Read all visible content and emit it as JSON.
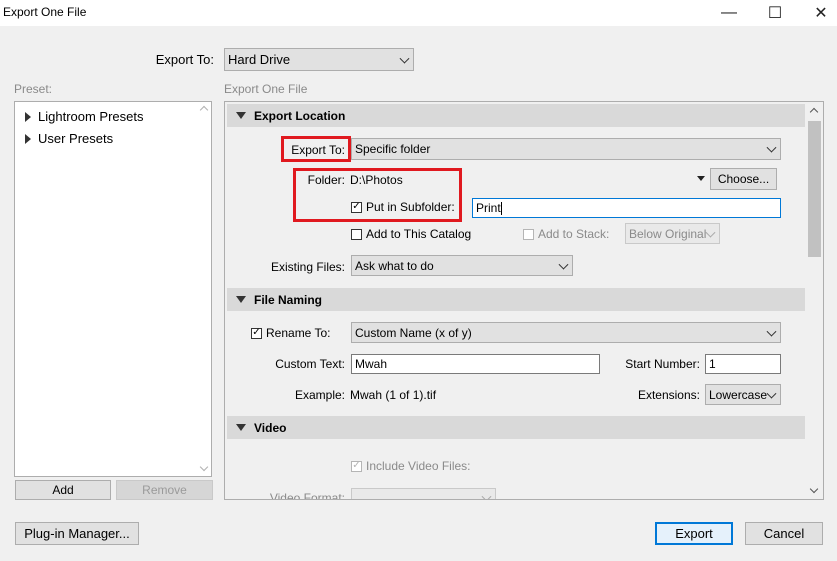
{
  "window": {
    "title": "Export One File",
    "minimize_glyph": "—",
    "maximize_glyph": "☐",
    "close_glyph": "✕"
  },
  "top": {
    "export_to_label": "Export To:",
    "export_to_value": "Hard Drive"
  },
  "preset": {
    "label": "Preset:",
    "items": [
      {
        "label": "Lightroom Presets"
      },
      {
        "label": "User Presets"
      }
    ],
    "add_label": "Add",
    "remove_label": "Remove"
  },
  "panel": {
    "label": "Export One File"
  },
  "export_location": {
    "header": "Export Location",
    "export_to_label": "Export To:",
    "export_to_value": "Specific folder",
    "folder_label": "Folder:",
    "folder_value": "D:\\Photos",
    "choose_label": "Choose...",
    "put_in_subfolder_label": "Put in Subfolder:",
    "put_in_subfolder_checked": true,
    "subfolder_value": "Print",
    "add_to_catalog_label": "Add to This Catalog",
    "add_to_stack_label": "Add to Stack:",
    "stack_position_value": "Below Original",
    "existing_files_label": "Existing Files:",
    "existing_files_value": "Ask what to do"
  },
  "file_naming": {
    "header": "File Naming",
    "rename_to_label": "Rename To:",
    "rename_checked": true,
    "rename_template_value": "Custom Name (x of y)",
    "custom_text_label": "Custom Text:",
    "custom_text_value": "Mwah",
    "start_number_label": "Start Number:",
    "start_number_value": "1",
    "example_label": "Example:",
    "example_value": "Mwah (1 of 1).tif",
    "extensions_label": "Extensions:",
    "extensions_value": "Lowercase"
  },
  "video": {
    "header": "Video",
    "include_video_label": "Include Video Files:",
    "video_format_label": "Video Format:"
  },
  "footer": {
    "plugin_manager_label": "Plug-in Manager...",
    "export_label": "Export",
    "cancel_label": "Cancel"
  },
  "colors": {
    "highlight": "#e0191f",
    "export_button_border": "#0078d7"
  }
}
